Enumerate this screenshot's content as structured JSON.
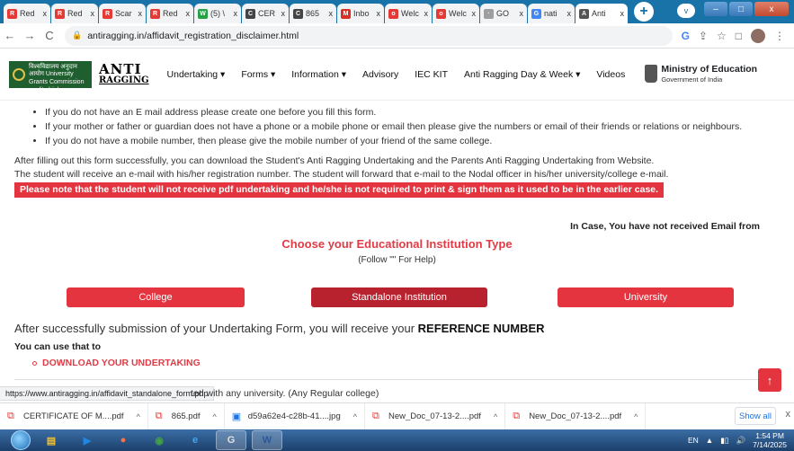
{
  "browser": {
    "tabs": [
      {
        "label": "Red",
        "fav_color": "#e53935",
        "fav": "R"
      },
      {
        "label": "Red",
        "fav_color": "#e53935",
        "fav": "R"
      },
      {
        "label": "Scar",
        "fav_color": "#e53935",
        "fav": "R"
      },
      {
        "label": "Red",
        "fav_color": "#e53935",
        "fav": "R"
      },
      {
        "label": "(5) \\",
        "fav_color": "#25a244",
        "fav": "W"
      },
      {
        "label": "CER",
        "fav_color": "#444444",
        "fav": "C"
      },
      {
        "label": "865",
        "fav_color": "#444444",
        "fav": "C"
      },
      {
        "label": "Inbo",
        "fav_color": "#d93025",
        "fav": "M"
      },
      {
        "label": "Welc",
        "fav_color": "#e53935",
        "fav": "o"
      },
      {
        "label": "Welc",
        "fav_color": "#e53935",
        "fav": "o"
      },
      {
        "label": "GO",
        "fav_color": "#9e9e9e",
        "fav": "·"
      },
      {
        "label": "nati",
        "fav_color": "#4285f4",
        "fav": "G"
      },
      {
        "label": "Anti",
        "fav_color": "#555555",
        "fav": "A"
      }
    ],
    "tab_close": "x",
    "new_tab": "+",
    "profile": "v",
    "window_controls": {
      "minimize": "–",
      "maximize": "□",
      "close": "x"
    },
    "nav": {
      "back": "←",
      "forward": "→",
      "reload": "C"
    },
    "url": "antiragging.in/affidavit_registration_disclaimer.html",
    "toolbar_icons": {
      "google": "G",
      "share": "⇪",
      "star": "☆",
      "sidepanel": "□"
    },
    "status_url": "https://www.antiragging.in/affidavit_standalone_form.php"
  },
  "site": {
    "ugc_text": "विश्वविद्यालय अनुदान आयोग University Grants Commission quality higher education for all",
    "logo_line1": "ANTI",
    "logo_line2": "RAGGING",
    "menu": [
      {
        "label": "Undertaking ▾"
      },
      {
        "label": "Forms ▾"
      },
      {
        "label": "Information ▾"
      },
      {
        "label": "Advisory"
      },
      {
        "label": "IEC KIT"
      },
      {
        "label": "Anti Ragging Day & Week ▾"
      },
      {
        "label": "Videos"
      }
    ],
    "ministry_title": "Ministry of Education",
    "ministry_sub": "Government of India"
  },
  "content": {
    "bullets": [
      "If you do not have an E mail address please create one before you fill this form.",
      "If your mother or father or guardian does not have a phone or a mobile phone or email then please give the numbers or email of their friends or relations or neighbours.",
      "If you do not have a mobile number, then please give the mobile number of your friend of the same college."
    ],
    "para1": "After filling out this form successfully, you can download the Student's Anti Ragging Undertaking and the Parents Anti Ragging Undertaking from Website.",
    "para2": "The student will receive an e-mail with his/her registration number. The student will forward that e-mail to the Nodal officer in his/her university/college e-mail.",
    "red_note": "Please note that the student will not receive pdf undertaking and he/she is not required to print & sign them as it used to be in the earlier case.",
    "in_case": "In Case, You have not received Email from",
    "choose_title": "Choose your Educational Institution Type",
    "follow_help": "(Follow \"\" For Help)",
    "buttons": [
      {
        "label": "College",
        "color": "#e4343f"
      },
      {
        "label": "Standalone Institution",
        "color": "#b8222e"
      },
      {
        "label": "University",
        "color": "#e4343f"
      }
    ],
    "after_text": "After successfully submission of your Undertaking Form, you will receive your ",
    "after_bold": "REFERENCE NUMBER",
    "can_use": "You can use that to",
    "download": "DOWNLOAD YOUR UNDERTAKING",
    "status_rest": "ted with any university. (Any Regular college)",
    "back_to_top": "↑"
  },
  "downloads": {
    "items": [
      {
        "name": "CERTIFICATE OF M....pdf",
        "kind": "pdf"
      },
      {
        "name": "865.pdf",
        "kind": "pdf"
      },
      {
        "name": "d59a62e4-c28b-41....jpg",
        "kind": "img"
      },
      {
        "name": "New_Doc_07-13-2....pdf",
        "kind": "pdf"
      },
      {
        "name": "New_Doc_07-13-2....pdf",
        "kind": "pdf"
      }
    ],
    "chevron": "^",
    "show_all": "Show all",
    "close": "x"
  },
  "taskbar": {
    "apps": [
      {
        "label": "▤",
        "color": "#f1c232"
      },
      {
        "label": "▶",
        "color": "#1e88e5"
      },
      {
        "label": "●",
        "color": "#ff7043"
      },
      {
        "label": "◉",
        "color": "#43a047"
      },
      {
        "label": "e",
        "color": "#42a5f5"
      },
      {
        "label": "G",
        "color": "#e0e0e0"
      },
      {
        "label": "W",
        "color": "#2b579a"
      }
    ],
    "lang": "EN",
    "time": "1:54 PM",
    "date": "7/14/2025"
  }
}
